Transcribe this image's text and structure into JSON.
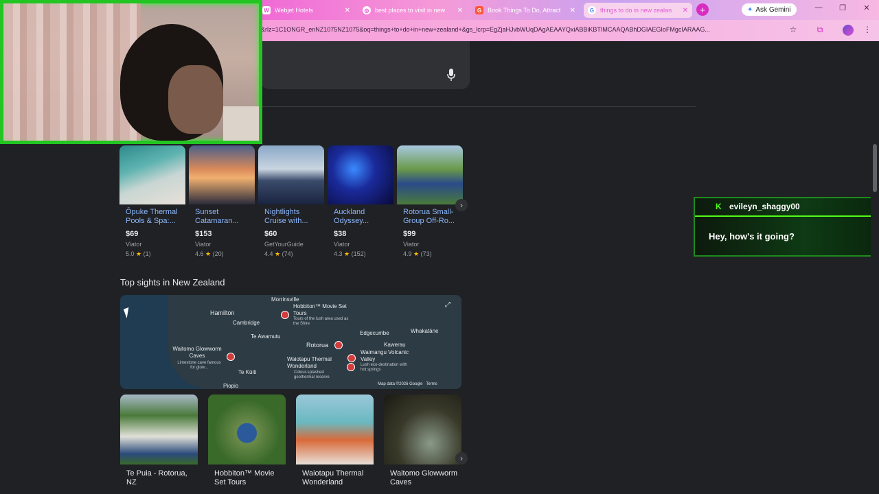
{
  "browser": {
    "tabs": [
      {
        "label": "Webjet Hotels",
        "icon": "webjet-icon"
      },
      {
        "label": "best places to visit in new",
        "icon": "chrome-icon"
      },
      {
        "label": "Book Things To Do, Attract",
        "icon": "getyourguide-icon"
      },
      {
        "label": "things to do in new zealan",
        "icon": "google-icon"
      }
    ],
    "ask_gemini": "Ask Gemini",
    "url": "&rlz=1C1ONGR_enNZ1075NZ1075&oq=things+to+do+in+new+zealand+&gs_lcrp=EgZjaHJvbWUqDAgAEAAYQxiABBiKBTIMCAAQABhDGIAEGIoFMgcIARAAG..."
  },
  "activities": [
    {
      "title": "Ōpuke Thermal Pools & Spa:...",
      "price": "$69",
      "source": "Viator",
      "rating": "5.0",
      "reviews": "(1)"
    },
    {
      "title": "Sunset Catamaran...",
      "price": "$153",
      "source": "Viator",
      "rating": "4.6",
      "reviews": "(20)"
    },
    {
      "title": "Nightlights Cruise with...",
      "price": "$60",
      "source": "GetYourGuide",
      "rating": "4.4",
      "reviews": "(74)"
    },
    {
      "title": "Auckland Odyssey...",
      "price": "$38",
      "source": "Viator",
      "rating": "4.3",
      "reviews": "(152)"
    },
    {
      "title": "Rotorua Small-Group Off-Ro...",
      "price": "$99",
      "source": "Viator",
      "rating": "4.9",
      "reviews": "(73)"
    }
  ],
  "sights_section_title": "Top sights in New Zealand",
  "map": {
    "places": [
      "Morrinsville",
      "Hamilton",
      "Cambridge",
      "Hobbiton™ Movie Set Tours",
      "Tours of the lush area used as the Shire",
      "Te Awamutu",
      "Edgecumbe",
      "Whakatāne",
      "Rotorua",
      "Kawerau",
      "Waitomo Glowworm Caves",
      "Limestone cave famous for glow...",
      "Waiotapu Thermal Wonderland",
      "Colour-splashed geothermal reserve",
      "Waimangu Volcanic Valley",
      "Lush eco-destination with hot springs",
      "Te Kūiti",
      "Piopio"
    ],
    "attribution": "Map data ©2026 Google",
    "terms": "Terms"
  },
  "sights": [
    {
      "title": "Te Puia - Rotorua, NZ"
    },
    {
      "title": "Hobbiton™ Movie Set Tours"
    },
    {
      "title": "Waiotapu Thermal Wonderland"
    },
    {
      "title": "Waitomo Glowworm Caves"
    }
  ],
  "chat": {
    "username": "evileyn_shaggy00",
    "message": "Hey, how's it going?"
  }
}
